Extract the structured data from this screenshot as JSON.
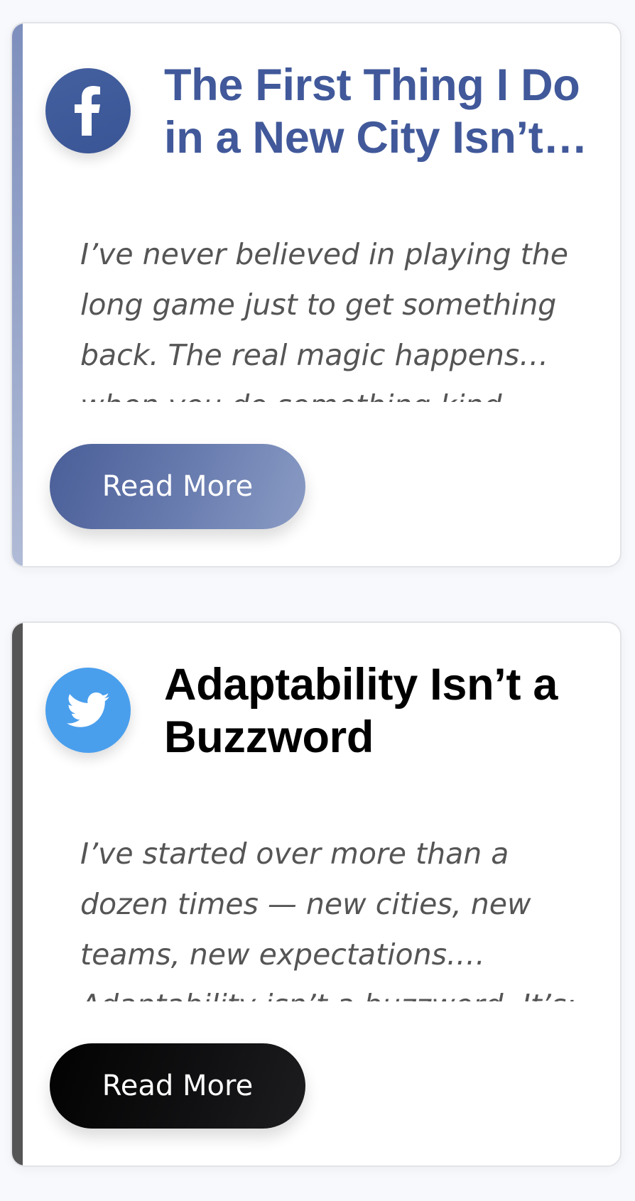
{
  "posts": [
    {
      "platform_icon": "facebook-icon",
      "accent_color": "#41599a",
      "title": "The First Thing I Do in a New City Isn’t Networking",
      "excerpt": "I’ve never believed in playing the long game just to get something back. The real magic happens… when you do something kind",
      "button_label": "Read More"
    },
    {
      "platform_icon": "twitter-icon",
      "accent_color": "#4a9fed",
      "title": "Adaptability Isn’t a Buzzword",
      "excerpt": "I’ve started over more than a dozen times — new cities, new teams, new expectations.… Adaptability isn’t a buzzword. It’s:",
      "button_label": "Read More"
    }
  ]
}
